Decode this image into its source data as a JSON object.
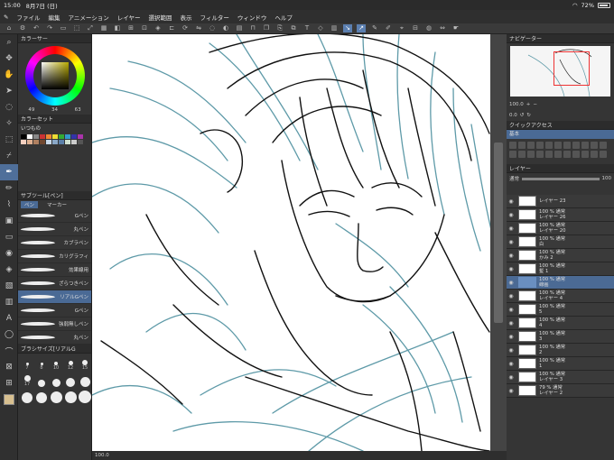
{
  "status": {
    "time": "15:00",
    "date": "8月7日 (日)",
    "battery": "72%"
  },
  "menu": [
    "ファイル",
    "編集",
    "アニメーション",
    "レイヤー",
    "選択範囲",
    "表示",
    "フィルター",
    "ウィンドウ",
    "ヘルプ"
  ],
  "color_panel": {
    "title": "カラーサー",
    "h": "49",
    "s": "34",
    "v": "63"
  },
  "color_set": {
    "title": "カラーセット",
    "name": "いつもの"
  },
  "subtool": {
    "title": "サブツール[ペン]",
    "tab_pen": "ペン",
    "tab_marker": "マーカー",
    "brushes": [
      "Gペン",
      "丸ペン",
      "カブラペン",
      "カリグラフィ",
      "効果線用",
      "ざらつきペン",
      "リアルGペン",
      "Gペン",
      "強弱無しペン",
      "丸ペン"
    ]
  },
  "brush_size": {
    "title": "ブラシサイズ[リアルG",
    "labels": [
      "7",
      "8",
      "10",
      "12",
      "15",
      "17"
    ]
  },
  "canvas_bottom": {
    "zoom": "100.0"
  },
  "navigator": {
    "title": "ナビゲーター",
    "zoom": "100.0",
    "angle": "0.0"
  },
  "quick_access": {
    "title": "クイックアクセス",
    "tab": "基本"
  },
  "layers": {
    "title": "レイヤー",
    "blend": "通常",
    "opacity": "100",
    "items": [
      {
        "line1": "レイヤー 23",
        "line2": ""
      },
      {
        "line1": "100 % 通常",
        "line2": "レイヤー 26"
      },
      {
        "line1": "100 % 通常",
        "line2": "レイヤー 20"
      },
      {
        "line1": "100 % 通常",
        "line2": "白"
      },
      {
        "line1": "100 % 通常",
        "line2": "かみ 2"
      },
      {
        "line1": "100 % 通常",
        "line2": "髪 1"
      },
      {
        "line1": "100 % 通常",
        "line2": "線画"
      },
      {
        "line1": "100 % 通常",
        "line2": "レイヤー 4"
      },
      {
        "line1": "100 % 通常",
        "line2": "5"
      },
      {
        "line1": "100 % 通常",
        "line2": "4"
      },
      {
        "line1": "100 % 通常",
        "line2": "3"
      },
      {
        "line1": "100 % 通常",
        "line2": "2"
      },
      {
        "line1": "100 % 通常",
        "line2": "1"
      },
      {
        "line1": "100 % 通常",
        "line2": "レイヤー 3"
      },
      {
        "line1": "79 % 通常",
        "line2": "レイヤー 2"
      }
    ]
  }
}
